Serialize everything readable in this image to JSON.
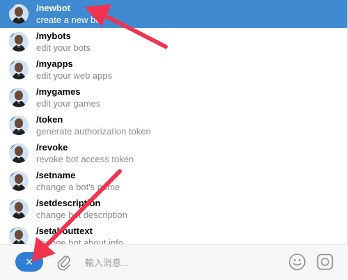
{
  "commands": [
    {
      "name": "/newbot",
      "desc": "create a new bot",
      "selected": true
    },
    {
      "name": "/mybots",
      "desc": "edit your bots",
      "selected": false
    },
    {
      "name": "/myapps",
      "desc": "edit your web apps",
      "selected": false
    },
    {
      "name": "/mygames",
      "desc": "edit your games",
      "selected": false
    },
    {
      "name": "/token",
      "desc": "generate authorization token",
      "selected": false
    },
    {
      "name": "/revoke",
      "desc": "revoke bot access token",
      "selected": false
    },
    {
      "name": "/setname",
      "desc": "change a bot's name",
      "selected": false
    },
    {
      "name": "/setdescription",
      "desc": "change bot description",
      "selected": false
    },
    {
      "name": "/setabouttext",
      "desc": "change bot about info",
      "selected": false
    }
  ],
  "composer": {
    "close_icon": "×",
    "input_placeholder": "輸入消息...",
    "icons": {
      "close": "close-icon",
      "attach": "paperclip-icon",
      "emoji": "emoji-icon",
      "camera": "camera-icon"
    }
  },
  "colors": {
    "selected_row": "#3f8ad0",
    "close_button": "#2f7dd4",
    "annotation_arrow": "#f2334f"
  }
}
